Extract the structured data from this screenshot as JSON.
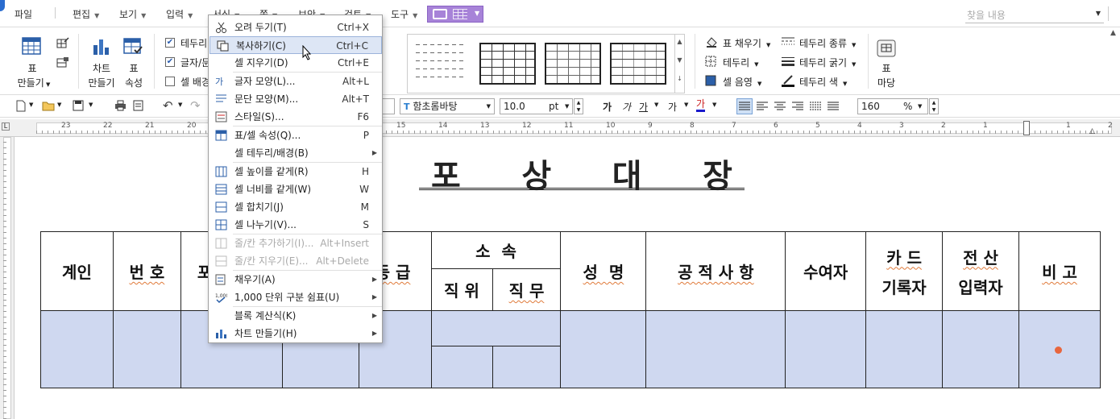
{
  "menubar": {
    "items": [
      "파일",
      "편집",
      "보기",
      "입력",
      "서식",
      "쪽",
      "보안",
      "검토",
      "도구"
    ],
    "search_placeholder": "찾을 내용"
  },
  "ribbon": {
    "table_make": "표\n만들기",
    "table_make_l1": "표",
    "table_make_l2": "만들기",
    "chart_make_l1": "차트",
    "chart_make_l2": "만들기",
    "table_prop_l1": "표",
    "table_prop_l2": "속성",
    "chk_border": "테두리",
    "chk_text": "글자/문",
    "chk_cellbg": "셀 배경",
    "fill": "표 채우기",
    "border": "테두리",
    "cell_shade": "셀 음영",
    "border_type": "테두리 종류",
    "border_thick": "테두리 굵기",
    "border_color": "테두리 색",
    "table_court_l1": "표",
    "table_court_l2": "마당"
  },
  "toolbar": {
    "font_name": "함초롬바탕",
    "font_size": "10.0",
    "size_unit": "pt",
    "zoom": "160",
    "zoom_unit": "%",
    "char_buttons": [
      "가",
      "가",
      "가",
      "가",
      "가"
    ]
  },
  "ruler": {
    "numbers": [
      "23",
      "22",
      "21",
      "20",
      "15",
      "14",
      "13",
      "12",
      "11",
      "10",
      "9",
      "8",
      "7",
      "6",
      "5",
      "4",
      "3",
      "2",
      "1",
      "1",
      "2"
    ]
  },
  "document": {
    "title_chars": [
      "포",
      "상",
      "대",
      "장"
    ],
    "headers": {
      "gyein": "계인",
      "bunho": "번 호",
      "partial": "포",
      "grade_partial": "등 급",
      "soseok": "소  속",
      "jikwi": "직 위",
      "jikmu": "직 무",
      "seongmyeong": "성  명",
      "gongjeok": "공 적 사 항",
      "suyeoja": "수여자",
      "card_l1": "카 드",
      "card_l2": "기록자",
      "jeonsan_l1": "전 산",
      "jeonsan_l2": "입력자",
      "bigo": "비 고"
    }
  },
  "context_menu": {
    "items": [
      {
        "label": "오려 두기(T)",
        "shortcut": "Ctrl+X",
        "icon": "scissors-icon",
        "state": "normal"
      },
      {
        "label": "복사하기(C)",
        "shortcut": "Ctrl+C",
        "icon": "copy-icon",
        "state": "highlight"
      },
      {
        "label": "셀 지우기(D)",
        "shortcut": "Ctrl+E",
        "icon": "",
        "state": "normal"
      },
      {
        "label": "글자 모양(L)...",
        "shortcut": "Alt+L",
        "icon": "char-shape-icon",
        "state": "normal"
      },
      {
        "label": "문단 모양(M)...",
        "shortcut": "Alt+T",
        "icon": "paragraph-shape-icon",
        "state": "normal"
      },
      {
        "label": "스타일(S)...",
        "shortcut": "F6",
        "icon": "style-icon",
        "state": "normal"
      },
      {
        "label": "표/셀 속성(Q)...",
        "shortcut": "P",
        "icon": "table-prop-icon",
        "state": "normal"
      },
      {
        "label": "셀 테두리/배경(B)",
        "shortcut": "",
        "icon": "",
        "state": "submenu"
      },
      {
        "label": "셀 높이를 같게(R)",
        "shortcut": "H",
        "icon": "equal-height-icon",
        "state": "normal"
      },
      {
        "label": "셀 너비를 같게(W)",
        "shortcut": "W",
        "icon": "equal-width-icon",
        "state": "normal"
      },
      {
        "label": "셀 합치기(J)",
        "shortcut": "M",
        "icon": "merge-cells-icon",
        "state": "normal"
      },
      {
        "label": "셀 나누기(V)...",
        "shortcut": "S",
        "icon": "split-cells-icon",
        "state": "normal"
      },
      {
        "label": "줄/칸 추가하기(I)...",
        "shortcut": "Alt+Insert",
        "icon": "insert-rowcol-icon",
        "state": "disabled"
      },
      {
        "label": "줄/칸 지우기(E)...",
        "shortcut": "Alt+Delete",
        "icon": "delete-rowcol-icon",
        "state": "disabled"
      },
      {
        "label": "채우기(A)",
        "shortcut": "",
        "icon": "fill-icon",
        "state": "submenu"
      },
      {
        "label": "1,000 단위 구분 쉼표(U)",
        "shortcut": "",
        "icon": "thousand-sep-icon",
        "state": "submenu"
      },
      {
        "label": "블록 계산식(K)",
        "shortcut": "",
        "icon": "",
        "state": "submenu"
      },
      {
        "label": "차트 만들기(H)",
        "shortcut": "",
        "icon": "chart-icon",
        "state": "submenu"
      }
    ]
  },
  "colors": {
    "selection": "#cfd8f0",
    "accent": "#a783d8",
    "highlight": "#dde6f5"
  }
}
